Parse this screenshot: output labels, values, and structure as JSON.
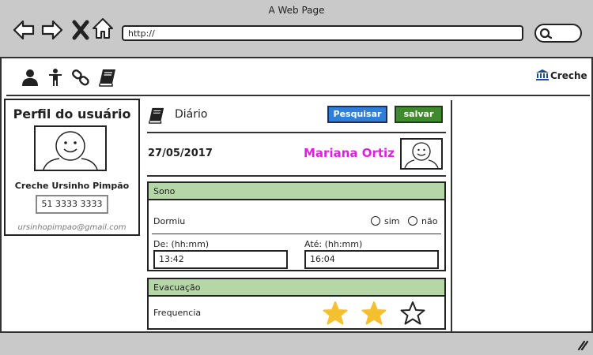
{
  "browser": {
    "title": "A Web Page",
    "url": "http://"
  },
  "header": {
    "icons": [
      "user-icon",
      "child-icon",
      "link-icon",
      "book-icon"
    ],
    "creche_label": "Creche"
  },
  "profile": {
    "title": "Perfil do usuário",
    "org": "Creche Ursinho Pimpão",
    "phone": "51 3333 3333",
    "email": "ursinhopimpao@gmail.com"
  },
  "diary": {
    "title": "Diário",
    "search_label": "Pesquisar",
    "save_label": "salvar",
    "date": "27/05/2017",
    "student_name": "Mariana Ortiz"
  },
  "sono": {
    "title": "Sono",
    "slept_label": "Dormiu",
    "option_yes": "sim",
    "option_no": "não",
    "from_label": "De: (hh:mm)",
    "from_value": "13:42",
    "to_label": "Até: (hh:mm)",
    "to_value": "16:04"
  },
  "evacuacao": {
    "title": "Evacuação",
    "freq_label": "Frequencia",
    "rating": 2,
    "rating_max": 3
  },
  "colors": {
    "search_button": "#2f7ed8",
    "save_button": "#3f8a2c",
    "section_header": "#b5d7a8",
    "student_name": "#e020e0",
    "star": "#f4c030"
  }
}
